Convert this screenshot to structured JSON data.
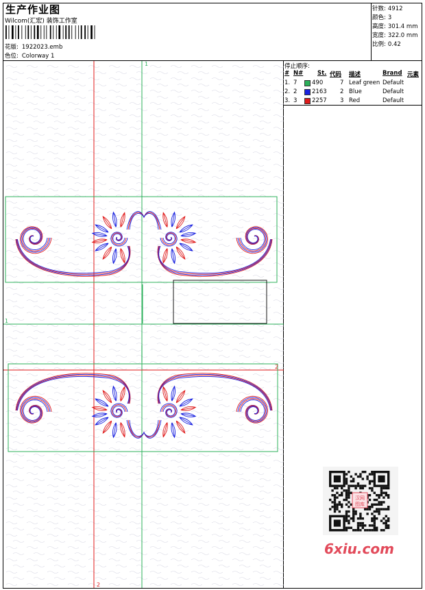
{
  "header": {
    "title": "生产作业图",
    "company": "Wilcom(汇宏) 装饰工作室",
    "file_label": "花版:",
    "file_value": "1922023.emb",
    "colorway_label": "色位:",
    "colorway_value": "Colorway 1"
  },
  "stats": [
    {
      "label": "针数:",
      "value": "4912"
    },
    {
      "label": "颜色:",
      "value": "3"
    },
    {
      "label": "高度:",
      "value": "301.4 mm"
    },
    {
      "label": "宽度:",
      "value": "322.0 mm"
    },
    {
      "label": "比例:",
      "value": "0.42"
    }
  ],
  "stop_sequence": {
    "title": "停止顺序:",
    "columns": [
      "#",
      "N#",
      "St.",
      "代码",
      "描述",
      "Brand",
      "元素"
    ],
    "rows": [
      {
        "num": "1.",
        "n": "7",
        "color": "#2bb05a",
        "st": "490",
        "code": "7",
        "desc": "Leaf green",
        "brand": "Default"
      },
      {
        "num": "2.",
        "n": "2",
        "color": "#1a22e0",
        "st": "2163",
        "code": "2",
        "desc": "Blue",
        "brand": "Default"
      },
      {
        "num": "3.",
        "n": "3",
        "color": "#e01a1a",
        "st": "2257",
        "code": "3",
        "desc": "Red",
        "brand": "Default"
      }
    ]
  },
  "guides": {
    "top_label": "1",
    "left_label": "1",
    "right_label": "2",
    "bottom_label": "2"
  },
  "colors": {
    "red": "#e01a1a",
    "blue": "#1a22e0",
    "green": "#2bb05a"
  },
  "watermark": "6xiu.com",
  "qr_stamp_text": "汉网图库"
}
